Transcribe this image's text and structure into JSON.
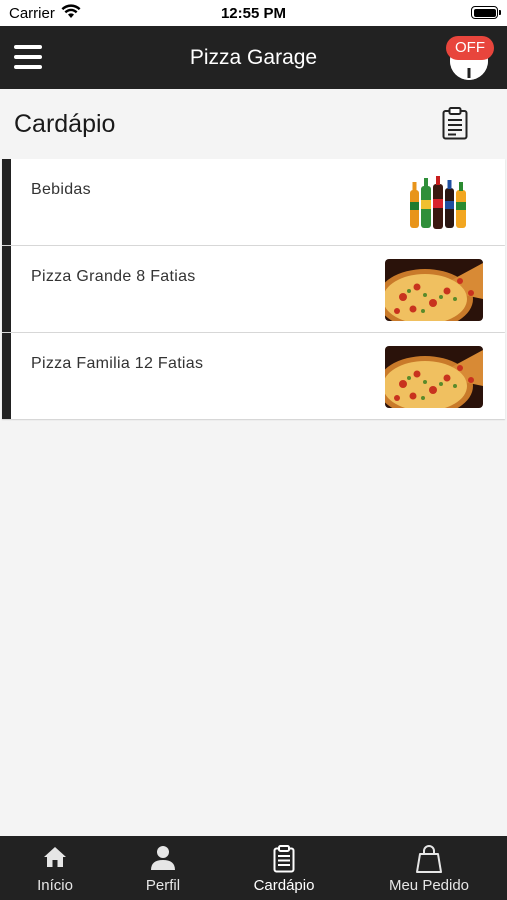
{
  "status_bar": {
    "carrier": "Carrier",
    "time": "12:55 PM",
    "battery_level": 1.0
  },
  "nav": {
    "title": "Pizza Garage",
    "status_badge": "OFF",
    "status_badge_color": "#e8453c"
  },
  "header": {
    "title": "Cardápio"
  },
  "menu_items": [
    {
      "label": "Bebidas",
      "thumbnail": "soda-bottles-image"
    },
    {
      "label": "Pizza Grande 8 Fatias",
      "thumbnail": "pizza-image"
    },
    {
      "label": "Pizza Familia 12 Fatias",
      "thumbnail": "pizza-image"
    }
  ],
  "tabs": [
    {
      "label": "Início",
      "icon": "home-icon",
      "active": false
    },
    {
      "label": "Perfil",
      "icon": "person-icon",
      "active": false
    },
    {
      "label": "Cardápio",
      "icon": "clipboard-icon",
      "active": true
    },
    {
      "label": "Meu Pedido",
      "icon": "shopping-bag-icon",
      "active": false
    }
  ],
  "colors": {
    "bar_background": "#222222",
    "page_background": "#f4f4f4",
    "badge": "#e8453c"
  }
}
